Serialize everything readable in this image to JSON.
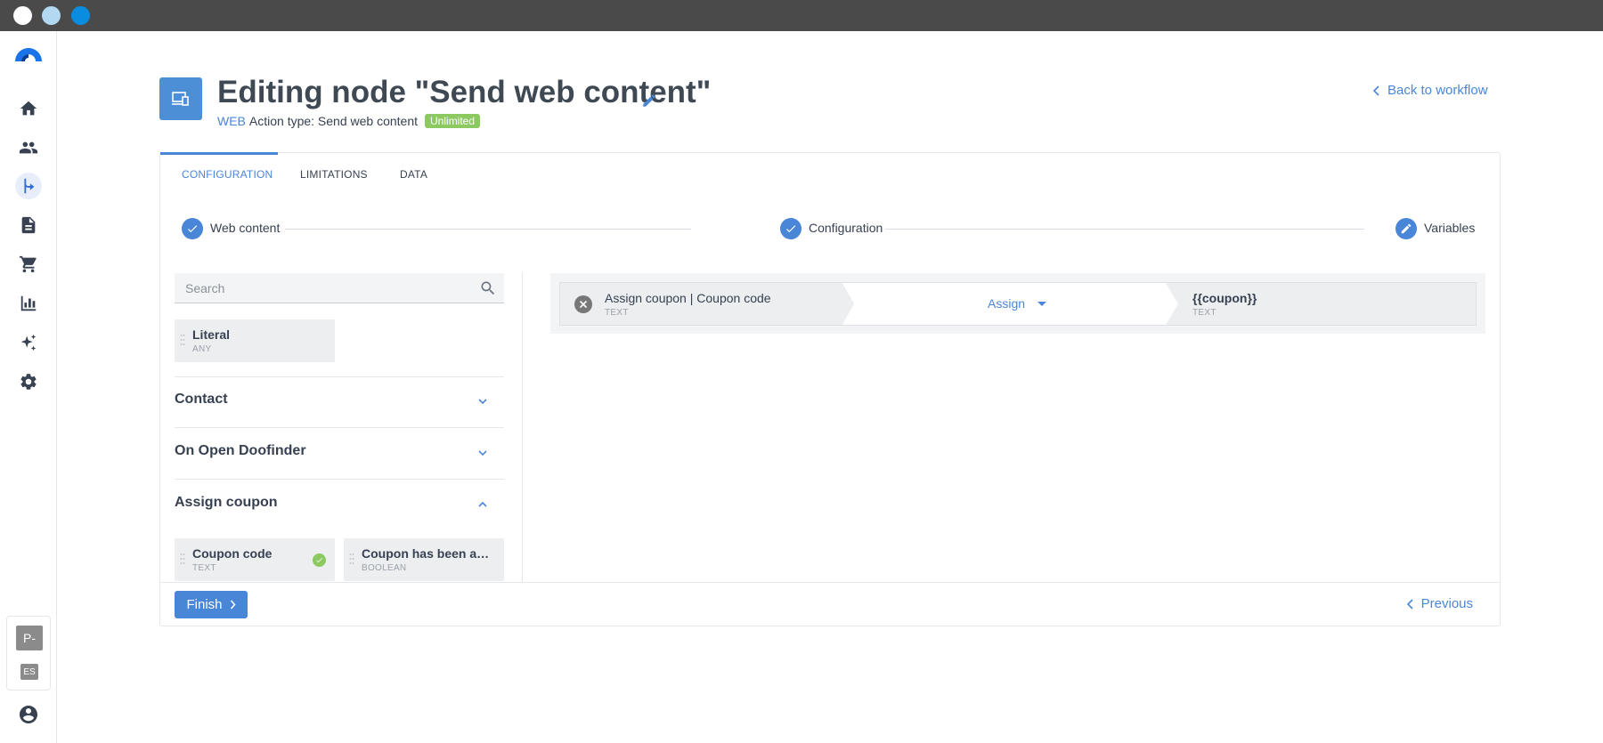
{
  "header": {
    "title": "Editing node \"Send web content\"",
    "channel": "WEB",
    "action_type": "Action type: Send web content",
    "badge": "Unlimited",
    "back_link": "Back to workflow"
  },
  "sidebar": {
    "items": [
      {
        "name": "home-icon"
      },
      {
        "name": "people-icon"
      },
      {
        "name": "workflow-icon",
        "active": true
      },
      {
        "name": "document-icon"
      },
      {
        "name": "cart-icon"
      },
      {
        "name": "bar-chart-icon"
      },
      {
        "name": "sparkle-icon"
      },
      {
        "name": "gear-icon"
      }
    ],
    "workspace_label": "P-",
    "language_label": "ES"
  },
  "tabs": [
    {
      "label": "CONFIGURATION",
      "active": true
    },
    {
      "label": "LIMITATIONS"
    },
    {
      "label": "DATA"
    }
  ],
  "stepper": [
    {
      "label": "Web content",
      "state": "done"
    },
    {
      "label": "Configuration",
      "state": "done"
    },
    {
      "label": "Variables",
      "state": "current"
    }
  ],
  "variables_panel": {
    "search_placeholder": "Search",
    "literal": {
      "name": "Literal",
      "type": "ANY"
    },
    "sections": [
      {
        "title": "Contact",
        "expanded": false
      },
      {
        "title": "On Open Doofinder",
        "expanded": false
      },
      {
        "title": "Assign coupon",
        "expanded": true,
        "items": [
          {
            "name": "Coupon code",
            "type": "TEXT",
            "selected": true
          },
          {
            "name": "Coupon has been assi...",
            "type": "BOOLEAN"
          }
        ]
      }
    ]
  },
  "mapping": {
    "source_name": "Assign coupon | Coupon code",
    "source_type": "TEXT",
    "operation": "Assign",
    "target_name": "{{coupon}}",
    "target_type": "TEXT"
  },
  "footer": {
    "finish_label": "Finish",
    "previous_label": "Previous"
  },
  "colors": {
    "accent": "#4a86d8",
    "success": "#8cc960",
    "titlebar": "#4a4a4a"
  }
}
